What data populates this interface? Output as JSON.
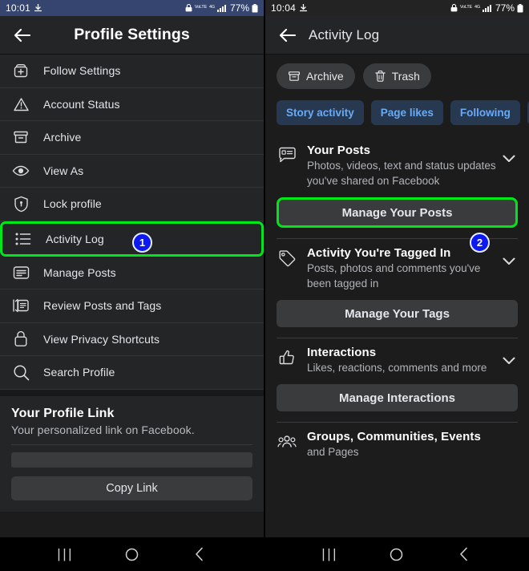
{
  "left_panel": {
    "status_bar": {
      "time": "10:01",
      "download_icon": "download-arrow-icon",
      "lock_icon": "alarm-lock-icon",
      "volte_label": "VoLTE",
      "network_label": "4G",
      "signal_icon": "signal-bars-icon",
      "battery_percent": "77%",
      "battery_icon": "battery-icon"
    },
    "header": {
      "back_icon": "back-arrow-icon",
      "title": "Profile Settings"
    },
    "menu_items": [
      {
        "label": "Follow Settings",
        "icon": "follow-settings-icon",
        "highlighted": false
      },
      {
        "label": "Account Status",
        "icon": "warning-triangle-icon",
        "highlighted": false
      },
      {
        "label": "Archive",
        "icon": "archive-box-icon",
        "highlighted": false
      },
      {
        "label": "View As",
        "icon": "eye-icon",
        "highlighted": false
      },
      {
        "label": "Lock profile",
        "icon": "shield-lock-icon",
        "highlighted": false
      },
      {
        "label": "Activity Log",
        "icon": "list-bullet-icon",
        "highlighted": true
      },
      {
        "label": "Manage Posts",
        "icon": "manage-posts-icon",
        "highlighted": false
      },
      {
        "label": "Review Posts and Tags",
        "icon": "review-posts-icon",
        "highlighted": false
      },
      {
        "label": "View Privacy Shortcuts",
        "icon": "padlock-icon",
        "highlighted": false
      },
      {
        "label": "Search Profile",
        "icon": "search-icon",
        "highlighted": false
      }
    ],
    "profile_link_card": {
      "title": "Your Profile Link",
      "subtitle": "Your personalized link on Facebook.",
      "field_value": "",
      "copy_button": "Copy Link"
    }
  },
  "right_panel": {
    "status_bar": {
      "time": "10:04",
      "download_icon": "download-arrow-icon",
      "lock_icon": "alarm-lock-icon",
      "volte_label": "VoLTE",
      "network_label": "4G",
      "signal_icon": "signal-bars-icon",
      "battery_percent": "77%",
      "battery_icon": "battery-icon"
    },
    "header": {
      "back_icon": "back-arrow-icon",
      "title": "Activity Log"
    },
    "pills": [
      {
        "label": "Archive",
        "icon": "archive-box-icon"
      },
      {
        "label": "Trash",
        "icon": "trash-can-icon"
      }
    ],
    "filter_chips": [
      {
        "label": "Story activity"
      },
      {
        "label": "Page likes"
      },
      {
        "label": "Following"
      },
      {
        "label": ""
      }
    ],
    "sections": [
      {
        "title": "Your Posts",
        "subtitle": "Photos, videos, text and status updates you've shared on Facebook",
        "icon": "post-bubble-icon",
        "chevron": "chevron-down-icon",
        "button": "Manage Your Posts",
        "button_highlighted": true
      },
      {
        "title": "Activity You're Tagged In",
        "subtitle": "Posts, photos and comments you've been tagged in",
        "icon": "tag-icon",
        "chevron": "chevron-down-icon",
        "button": "Manage Your Tags",
        "button_highlighted": false
      },
      {
        "title": "Interactions",
        "subtitle": "Likes, reactions, comments and more",
        "icon": "thumbs-up-icon",
        "chevron": "chevron-down-icon",
        "button": "Manage Interactions",
        "button_highlighted": false
      },
      {
        "title": "Groups, Communities, Events",
        "subtitle": "and Pages",
        "icon": "groups-people-icon",
        "chevron": "",
        "button": "",
        "button_highlighted": false
      }
    ]
  },
  "annotations": {
    "badge_1": "1",
    "badge_2": "2",
    "highlight_color": "#00e61a",
    "badge_color": "#0c19f0"
  },
  "navbar": {
    "left": {
      "recents": "|||",
      "home": "home-circle-icon",
      "back": "back-chevron-icon"
    },
    "right": {
      "recents": "|||",
      "home": "home-circle-icon",
      "back": "back-chevron-icon"
    }
  }
}
